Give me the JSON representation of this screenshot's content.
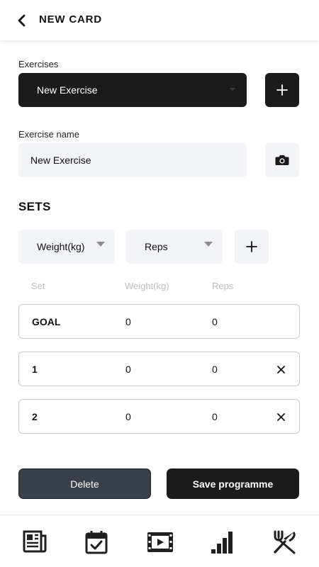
{
  "header": {
    "title": "NEW CARD"
  },
  "exercises": {
    "label": "Exercises",
    "selected": "New Exercise"
  },
  "exercise_name": {
    "label": "Exercise name",
    "value": "New Exercise"
  },
  "sets": {
    "title": "SETS",
    "unit_selects": [
      "Weight(kg)",
      "Reps"
    ],
    "columns": [
      "Set",
      "Weight(kg)",
      "Reps"
    ],
    "rows": [
      {
        "set": "GOAL",
        "weight": "0",
        "reps": "0",
        "removable": false
      },
      {
        "set": "1",
        "weight": "0",
        "reps": "0",
        "removable": true
      },
      {
        "set": "2",
        "weight": "0",
        "reps": "0",
        "removable": true
      }
    ]
  },
  "actions": {
    "delete_label": "Delete",
    "save_label": "Save programme"
  },
  "tabbar": {
    "items": [
      "news-icon",
      "calendar-check-icon",
      "video-icon",
      "stats-icon",
      "utensils-icon"
    ]
  }
}
